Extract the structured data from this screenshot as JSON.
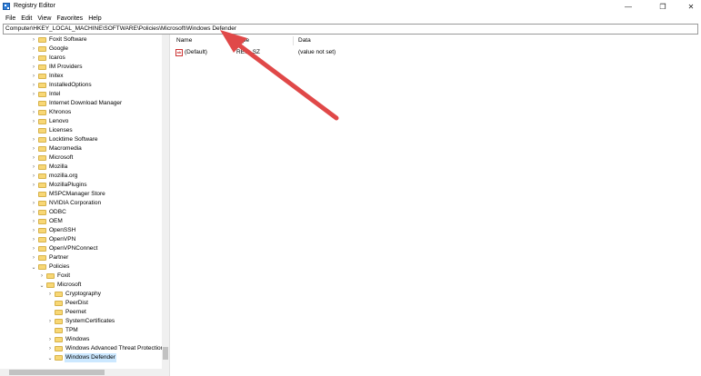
{
  "window": {
    "title": "Registry Editor",
    "controls": {
      "minimize": "—",
      "restore": "❐",
      "close": "✕"
    }
  },
  "menu": [
    "File",
    "Edit",
    "View",
    "Favorites",
    "Help"
  ],
  "address": "Computer\\HKEY_LOCAL_MACHINE\\SOFTWARE\\Policies\\Microsoft\\Windows Defender",
  "tree": [
    {
      "label": "Foxit Software",
      "level": 1,
      "expander": true
    },
    {
      "label": "Google",
      "level": 1,
      "expander": true
    },
    {
      "label": "Icaros",
      "level": 1,
      "expander": true
    },
    {
      "label": "IM Providers",
      "level": 1,
      "expander": true
    },
    {
      "label": "Initex",
      "level": 1,
      "expander": true
    },
    {
      "label": "InstalledOptions",
      "level": 1,
      "expander": true
    },
    {
      "label": "Intel",
      "level": 1,
      "expander": true
    },
    {
      "label": "Internet Download Manager",
      "level": 1,
      "expander": false
    },
    {
      "label": "Khronos",
      "level": 1,
      "expander": true
    },
    {
      "label": "Lenovo",
      "level": 1,
      "expander": true
    },
    {
      "label": "Licenses",
      "level": 1,
      "expander": false
    },
    {
      "label": "Locktime Software",
      "level": 1,
      "expander": true
    },
    {
      "label": "Macromedia",
      "level": 1,
      "expander": true
    },
    {
      "label": "Microsoft",
      "level": 1,
      "expander": true
    },
    {
      "label": "Mozilla",
      "level": 1,
      "expander": true
    },
    {
      "label": "mozilla.org",
      "level": 1,
      "expander": true
    },
    {
      "label": "MozillaPlugins",
      "level": 1,
      "expander": true
    },
    {
      "label": "MSPCManager Store",
      "level": 1,
      "expander": false
    },
    {
      "label": "NVIDIA Corporation",
      "level": 1,
      "expander": true
    },
    {
      "label": "ODBC",
      "level": 1,
      "expander": true
    },
    {
      "label": "OEM",
      "level": 1,
      "expander": true
    },
    {
      "label": "OpenSSH",
      "level": 1,
      "expander": true
    },
    {
      "label": "OpenVPN",
      "level": 1,
      "expander": true
    },
    {
      "label": "OpenVPNConnect",
      "level": 1,
      "expander": true
    },
    {
      "label": "Partner",
      "level": 1,
      "expander": true
    },
    {
      "label": "Policies",
      "level": 1,
      "expander": true,
      "expanded": true
    },
    {
      "label": "Foxit",
      "level": 2,
      "expander": true
    },
    {
      "label": "Microsoft",
      "level": 2,
      "expander": true,
      "expanded": true
    },
    {
      "label": "Cryptography",
      "level": 3,
      "expander": true
    },
    {
      "label": "PeerDist",
      "level": 3,
      "expander": false
    },
    {
      "label": "Peernet",
      "level": 3,
      "expander": false
    },
    {
      "label": "SystemCertificates",
      "level": 3,
      "expander": true
    },
    {
      "label": "TPM",
      "level": 3,
      "expander": false
    },
    {
      "label": "Windows",
      "level": 3,
      "expander": true
    },
    {
      "label": "Windows Advanced Threat Protection",
      "level": 3,
      "expander": true
    },
    {
      "label": "Windows Defender",
      "level": 3,
      "expander": true,
      "expanded": true,
      "selected": true
    }
  ],
  "list": {
    "columns": [
      "Name",
      "Type",
      "Data"
    ],
    "rows": [
      {
        "name": "(Default)",
        "type": "REG_SZ",
        "data": "(value not set)"
      }
    ]
  },
  "annotation": {
    "arrow_color": "#e04848"
  },
  "colors": {
    "selection": "#cce8ff",
    "folder": "#f8d775"
  }
}
